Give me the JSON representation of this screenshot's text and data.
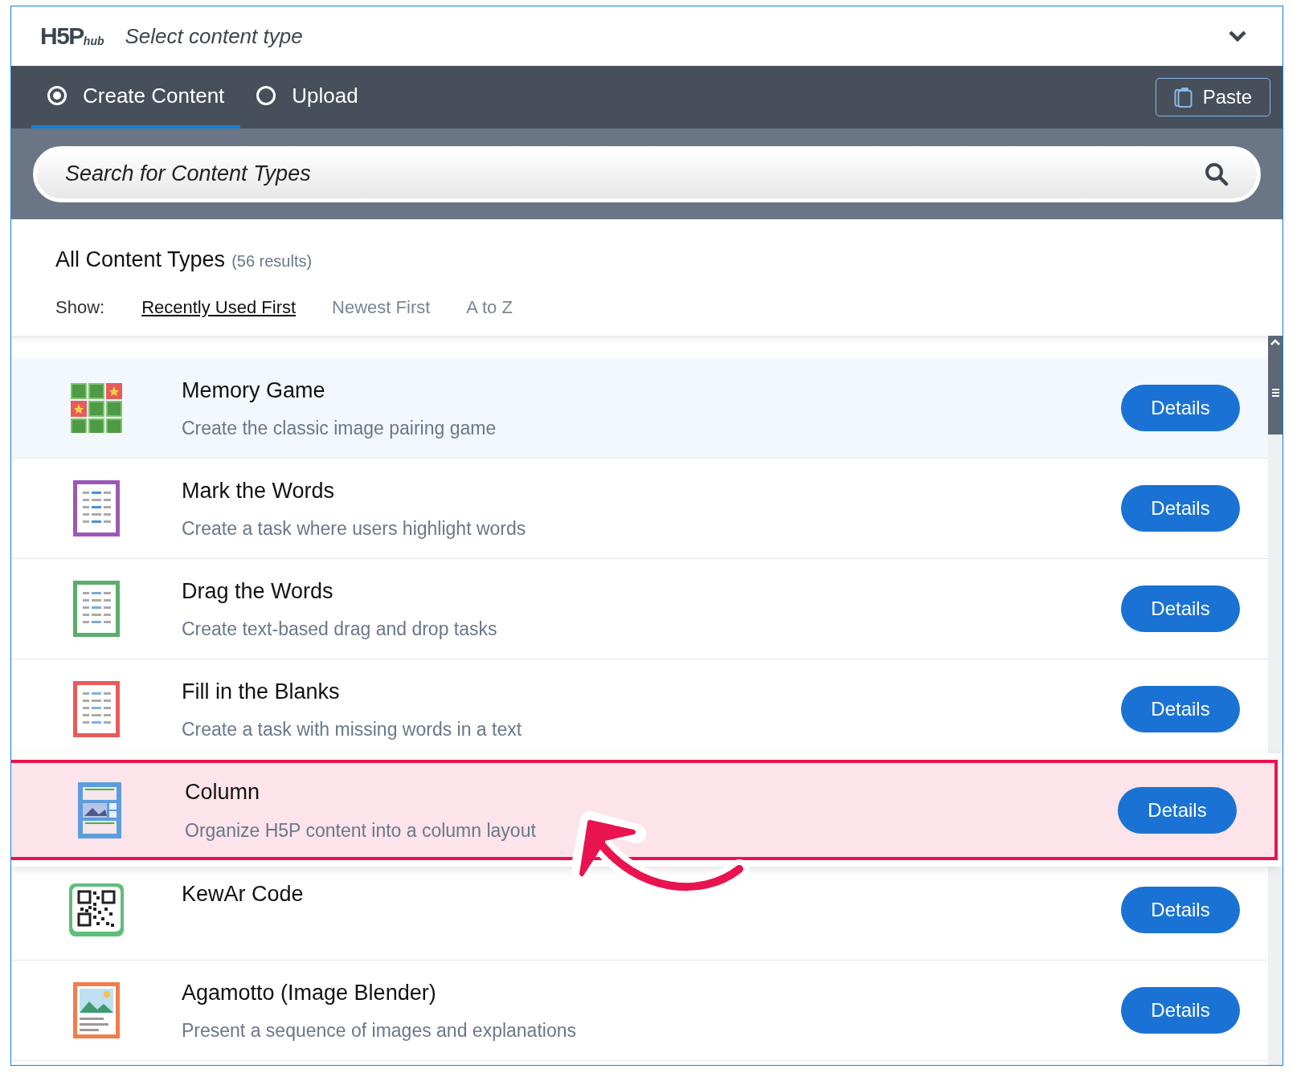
{
  "header": {
    "logo": {
      "mark": "H5P",
      "sub": "hub"
    },
    "title": "Select content type"
  },
  "tabs": [
    {
      "label": "Create Content",
      "selected": true
    },
    {
      "label": "Upload",
      "selected": false
    }
  ],
  "paste_button": {
    "label": "Paste"
  },
  "search": {
    "placeholder": "Search for Content Types"
  },
  "results": {
    "heading": "All Content Types",
    "count": "(56 results)"
  },
  "sort": {
    "label": "Show:",
    "options": [
      {
        "label": "Recently Used First",
        "selected": true
      },
      {
        "label": "Newest First",
        "selected": false
      },
      {
        "label": "A to Z",
        "selected": false
      }
    ]
  },
  "items": [
    {
      "kind": "memory",
      "title": "Memory Game",
      "description": "Create the classic image pairing game",
      "highlighted": true,
      "annotated": false,
      "button": "Details"
    },
    {
      "kind": "mark",
      "title": "Mark the Words",
      "description": "Create a task where users highlight words",
      "highlighted": false,
      "annotated": false,
      "button": "Details"
    },
    {
      "kind": "drag",
      "title": "Drag the Words",
      "description": "Create text-based drag and drop tasks",
      "highlighted": false,
      "annotated": false,
      "button": "Details"
    },
    {
      "kind": "fill",
      "title": "Fill in the Blanks",
      "description": "Create a task with missing words in a text",
      "highlighted": false,
      "annotated": false,
      "button": "Details"
    },
    {
      "kind": "column",
      "title": "Column",
      "description": "Organize H5P content into a column layout",
      "highlighted": false,
      "annotated": true,
      "button": "Details"
    },
    {
      "kind": "qr",
      "title": "KewAr Code",
      "highlighted": false,
      "annotated": false,
      "button": "Details"
    },
    {
      "kind": "image",
      "title": "Agamotto (Image Blender)",
      "description": "Present a sequence of images and explanations",
      "highlighted": false,
      "annotated": false,
      "button": "Details"
    }
  ]
}
